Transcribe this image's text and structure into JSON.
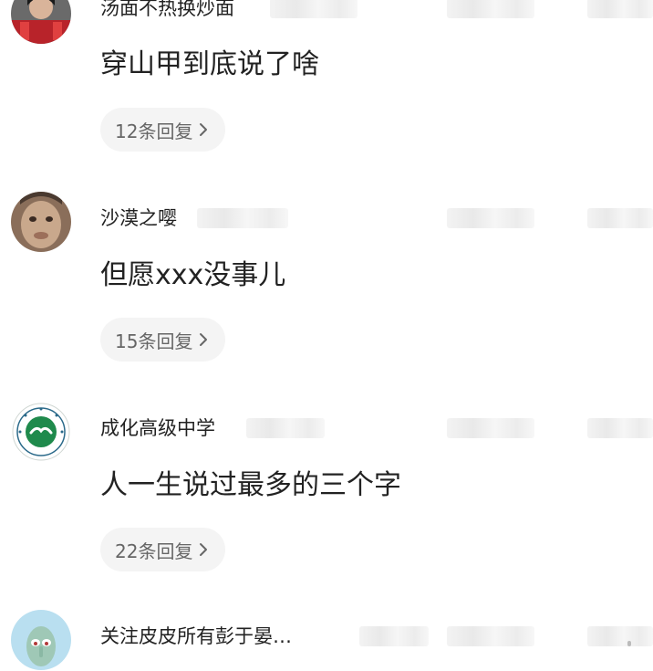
{
  "comments": [
    {
      "username": "汤面不热换炒面",
      "text": "穿山甲到底说了啥",
      "reply_count": "12条回复",
      "avatar": "avatar-person-red-jacket"
    },
    {
      "username": "沙漠之嘤",
      "text": "但愿xxx没事儿",
      "reply_count": "15条回复",
      "avatar": "avatar-face-portrait"
    },
    {
      "username": "成化高级中学",
      "text": "人一生说过最多的三个字",
      "reply_count": "22条回复",
      "avatar": "avatar-school-emblem"
    },
    {
      "username": "关注皮皮所有彭于晏…",
      "text": "",
      "reply_count": "",
      "avatar": "avatar-cartoon-squidward"
    }
  ],
  "icons": {
    "reply_chevron": "chevron-right-icon"
  },
  "colors": {
    "reply_pill_bg": "#f4f4f4",
    "reply_text": "#666666",
    "body_text": "#222222",
    "school_green": "#1f8a4c"
  }
}
